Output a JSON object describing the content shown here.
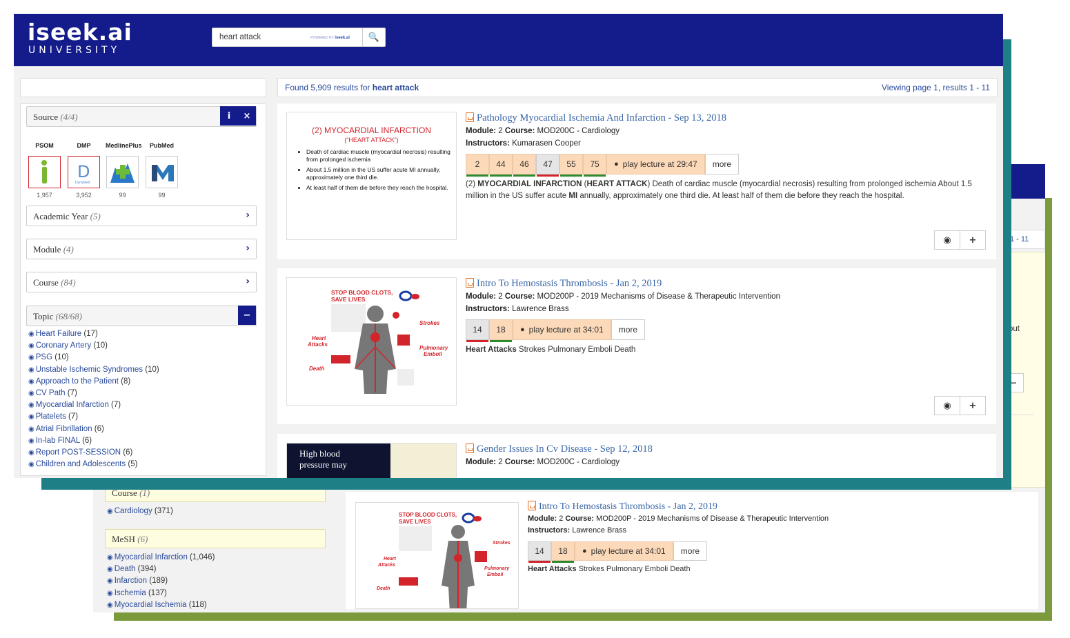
{
  "colors": {
    "navy": "#141b8a",
    "teal": "#1e7f86",
    "green": "#7a9a3c",
    "link": "#2a4b9b",
    "title": "#3a67a8",
    "chip": "#fcd9b8"
  },
  "logo": {
    "line1": "iseek.ai",
    "line2": "UNIVERSITY"
  },
  "search": {
    "value": "heart attack",
    "powered_by": "POWERED BY",
    "powered_brand": "iseek.ai",
    "button_icon": "search-icon"
  },
  "results_bar": {
    "found_prefix": "Found 5,909 results for",
    "query": "heart attack",
    "viewing": "Viewing page 1, results 1 - 11"
  },
  "source_facet": {
    "label": "Source",
    "count": "(4/4)",
    "info_icon": "i",
    "close_icon": "×",
    "sources": [
      {
        "name": "PSOM",
        "count": "1,957",
        "logo": "psom-logo"
      },
      {
        "name": "DMP",
        "count": "3,952",
        "logo": "dmp-logo",
        "sub": "DynaMed"
      },
      {
        "name": "MedlinePlus",
        "count": "99",
        "logo": "medlineplus-logo"
      },
      {
        "name": "PubMed",
        "count": "99",
        "logo": "pubmed-logo"
      }
    ]
  },
  "facets": [
    {
      "label": "Academic Year",
      "count": "(5)"
    },
    {
      "label": "Module",
      "count": "(4)"
    },
    {
      "label": "Course",
      "count": "(84)"
    }
  ],
  "topic_facet": {
    "label": "Topic",
    "count": "(68/68)",
    "collapse_icon": "−",
    "items": [
      {
        "name": "Heart Failure",
        "count": "(17)"
      },
      {
        "name": "Coronary Artery",
        "count": "(10)"
      },
      {
        "name": "PSG",
        "count": "(10)"
      },
      {
        "name": "Unstable Ischemic Syndromes",
        "count": "(10)"
      },
      {
        "name": "Approach to the Patient",
        "count": "(8)"
      },
      {
        "name": "CV Path",
        "count": "(7)"
      },
      {
        "name": "Myocardial Infarction",
        "count": "(7)"
      },
      {
        "name": "Platelets",
        "count": "(7)"
      },
      {
        "name": "Atrial Fibrillation",
        "count": "(6)"
      },
      {
        "name": "In-lab FINAL",
        "count": "(6)"
      },
      {
        "name": "Report POST-SESSION",
        "count": "(6)"
      },
      {
        "name": "Children and Adolescents",
        "count": "(5)"
      }
    ]
  },
  "results": [
    {
      "title": "Pathology Myocardial Ischemia And Infarction - Sep 13, 2018",
      "module_label": "Module:",
      "module": "2",
      "course_label": "Course:",
      "course": "MOD200C - Cardiology",
      "instructors_label": "Instructors:",
      "instructors": "Kumarasen Cooper",
      "chips": [
        "2",
        "44",
        "46",
        "47",
        "55",
        "75"
      ],
      "play": "play lecture at 29:47",
      "more": "more",
      "snippet_pre": "(2) ",
      "snippet_b1": "MYOCARDIAL INFARCTION",
      "snippet_mid1": " (",
      "snippet_b2": "HEART ATTACK",
      "snippet_mid2": ") Death of cardiac muscle (myocardial necrosis) resulting from prolonged ischemia About 1.5 million in the US suffer acute ",
      "snippet_b3": "MI",
      "snippet_post": " annually, approximately one third die. At least half of them die before they reach the hospital.",
      "thumb": {
        "title1": "(2) MYOCARDIAL INFARCTION",
        "title2": "(“HEART ATTACK”)",
        "bullets": [
          "Death of cardiac muscle  (myocardial necrosis) resulting from prolonged ischemia",
          "About 1.5 million in the US suffer acute MI annually, approximately one third die.",
          "At least half of them die before they reach the hospital."
        ]
      }
    },
    {
      "title": "Intro To Hemostasis Thrombosis - Jan 2, 2019",
      "module_label": "Module:",
      "module": "2",
      "course_label": "Course:",
      "course": "MOD200P - 2019 Mechanisms of Disease & Therapeutic Intervention",
      "instructors_label": "Instructors:",
      "instructors": "Lawrence Brass",
      "chips": [
        "14",
        "18"
      ],
      "play": "play lecture at 34:01",
      "more": "more",
      "snippet_b1": "Heart Attacks",
      "snippet_post": " Strokes Pulmonary Emboli Death",
      "thumb": {
        "head1": "STOP BLOOD CLOTS,",
        "head2": "SAVE LIVES",
        "l_heart": "Heart",
        "l_attacks": "Attacks",
        "l_death": "Death",
        "l_strokes": "Strokes",
        "l_pulm": "Pulmonary",
        "l_emboli": "Emboli"
      }
    },
    {
      "title": "Gender Issues In Cv Disease - Sep 12, 2018",
      "module_label": "Module:",
      "module": "2",
      "course_label": "Course:",
      "course": "MOD200C - Cardiology",
      "thumb": {
        "line1": "High blood",
        "line2": "pressure may"
      }
    }
  ],
  "back_window": {
    "viewing_fragment": "1 - 11",
    "snippet_fragment": "out",
    "minus_icon": "−",
    "course_facet": {
      "label": "Course",
      "count": "(1)"
    },
    "course_items": [
      {
        "name": "Cardiology",
        "count": "(371)"
      }
    ],
    "mesh_facet": {
      "label": "MeSH",
      "count": "(6)"
    },
    "mesh_items": [
      {
        "name": "Myocardial Infarction",
        "count": "(1,046)"
      },
      {
        "name": "Death",
        "count": "(394)"
      },
      {
        "name": "Infarction",
        "count": "(189)"
      },
      {
        "name": "Ischemia",
        "count": "(137)"
      },
      {
        "name": "Myocardial Ischemia",
        "count": "(118)"
      }
    ],
    "result": {
      "title": "Intro To Hemostasis Thrombosis - Jan 2, 2019",
      "module_label": "Module:",
      "module": "2",
      "course_label": "Course:",
      "course": "MOD200P - 2019 Mechanisms of Disease & Therapeutic Intervention",
      "instructors_label": "Instructors:",
      "instructors": "Lawrence Brass",
      "chips": [
        "14",
        "18"
      ],
      "play": "play lecture at 34:01",
      "more": "more",
      "snippet_b1": "Heart Attacks",
      "snippet_post": " Strokes Pulmonary Emboli Death"
    }
  }
}
